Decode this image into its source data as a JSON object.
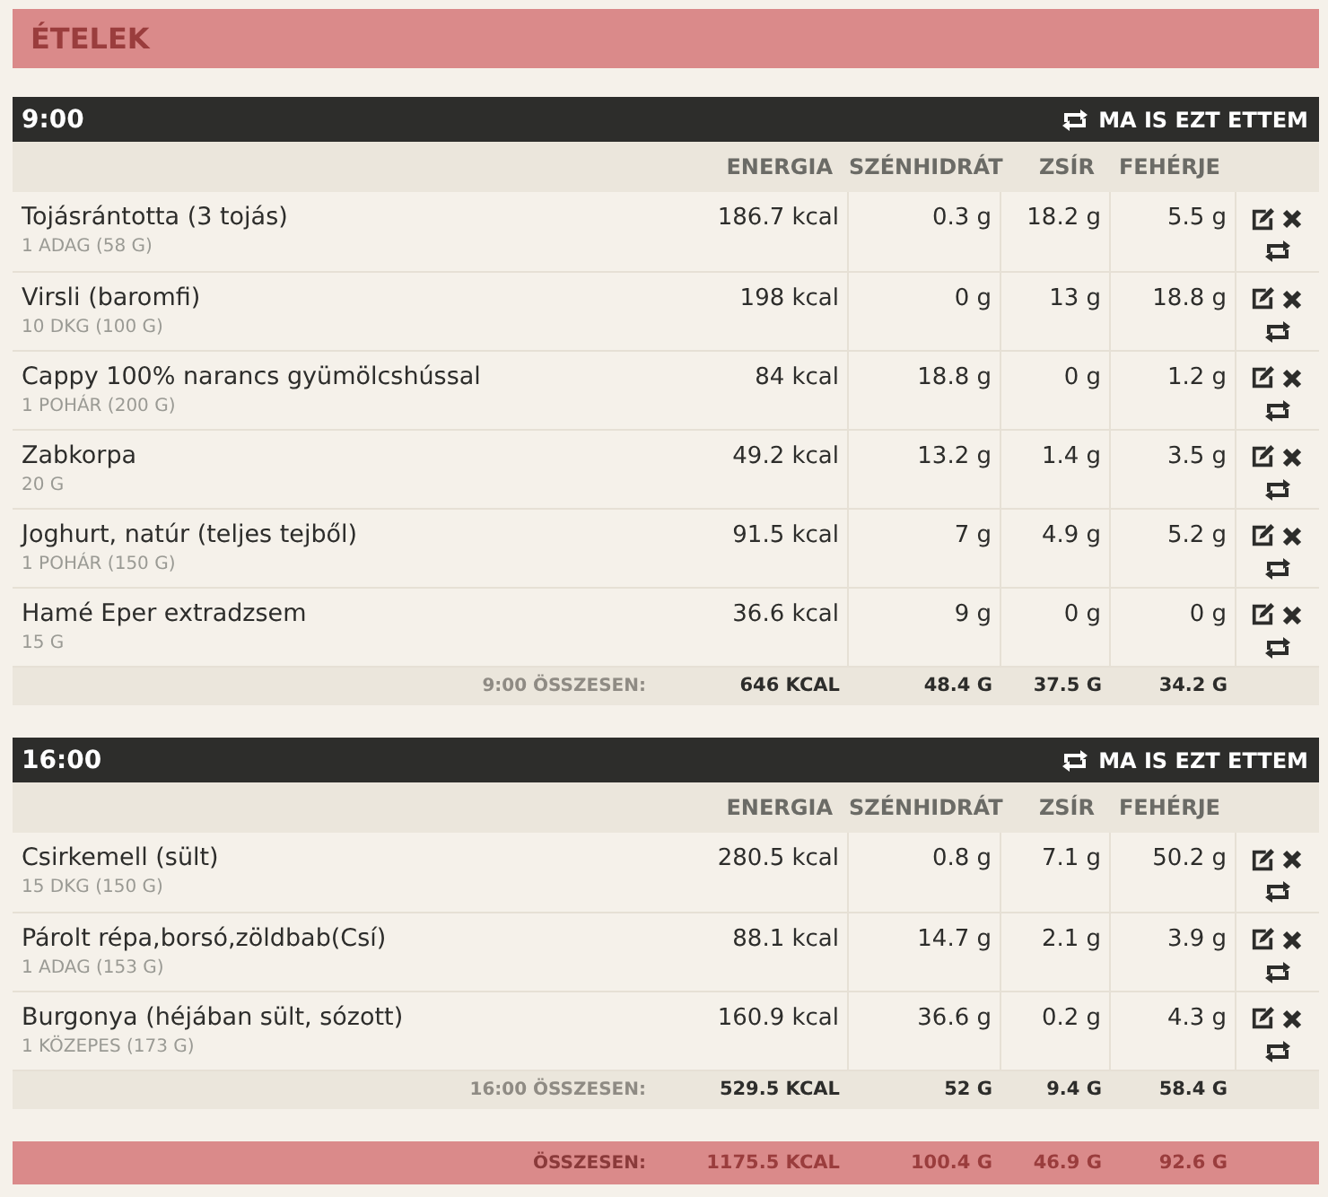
{
  "title": "ÉTELEK",
  "meals": [
    {
      "time": "9:00",
      "repeat_label": "MA IS EZT ETTEM",
      "columns": [
        "ENERGIA",
        "SZÉNHIDRÁT",
        "ZSÍR",
        "FEHÉRJE"
      ],
      "items": [
        {
          "name": "Tojásrántotta (3 tojás)",
          "portion": "1 ADAG (58 G)",
          "values": [
            "186.7 kcal",
            "0.3 g",
            "18.2 g",
            "5.5 g"
          ]
        },
        {
          "name": "Virsli (baromfi)",
          "portion": "10 DKG (100 G)",
          "values": [
            "198 kcal",
            "0 g",
            "13 g",
            "18.8 g"
          ]
        },
        {
          "name": "Cappy 100% narancs gyümölcshússal",
          "portion": "1 POHÁR (200 G)",
          "values": [
            "84 kcal",
            "18.8 g",
            "0 g",
            "1.2 g"
          ]
        },
        {
          "name": "Zabkorpa",
          "portion": "20 G",
          "values": [
            "49.2 kcal",
            "13.2 g",
            "1.4 g",
            "3.5 g"
          ]
        },
        {
          "name": "Joghurt, natúr (teljes tejből)",
          "portion": "1 POHÁR (150 G)",
          "values": [
            "91.5 kcal",
            "7 g",
            "4.9 g",
            "5.2 g"
          ]
        },
        {
          "name": "Hamé Eper extradzsem",
          "portion": "15 G",
          "values": [
            "36.6 kcal",
            "9 g",
            "0 g",
            "0 g"
          ]
        }
      ],
      "total_label": "9:00 ÖSSZESEN:",
      "totals": [
        "646 KCAL",
        "48.4 G",
        "37.5 G",
        "34.2 G"
      ]
    },
    {
      "time": "16:00",
      "repeat_label": "MA IS EZT ETTEM",
      "columns": [
        "ENERGIA",
        "SZÉNHIDRÁT",
        "ZSÍR",
        "FEHÉRJE"
      ],
      "items": [
        {
          "name": "Csirkemell (sült)",
          "portion": "15 DKG (150 G)",
          "values": [
            "280.5 kcal",
            "0.8 g",
            "7.1 g",
            "50.2 g"
          ]
        },
        {
          "name": "Párolt répa,borsó,zöldbab(Csí)",
          "portion": "1 ADAG (153 G)",
          "values": [
            "88.1 kcal",
            "14.7 g",
            "2.1 g",
            "3.9 g"
          ]
        },
        {
          "name": "Burgonya (héjában sült, sózott)",
          "portion": "1 KÖZEPES (173 G)",
          "values": [
            "160.9 kcal",
            "36.6 g",
            "0.2 g",
            "4.3 g"
          ]
        }
      ],
      "total_label": "16:00 ÖSSZESEN:",
      "totals": [
        "529.5 KCAL",
        "52 G",
        "9.4 G",
        "58.4 G"
      ]
    }
  ],
  "grand_total": {
    "label": "ÖSSZESEN:",
    "values": [
      "1175.5 KCAL",
      "100.4 G",
      "46.9 G",
      "92.6 G"
    ]
  }
}
